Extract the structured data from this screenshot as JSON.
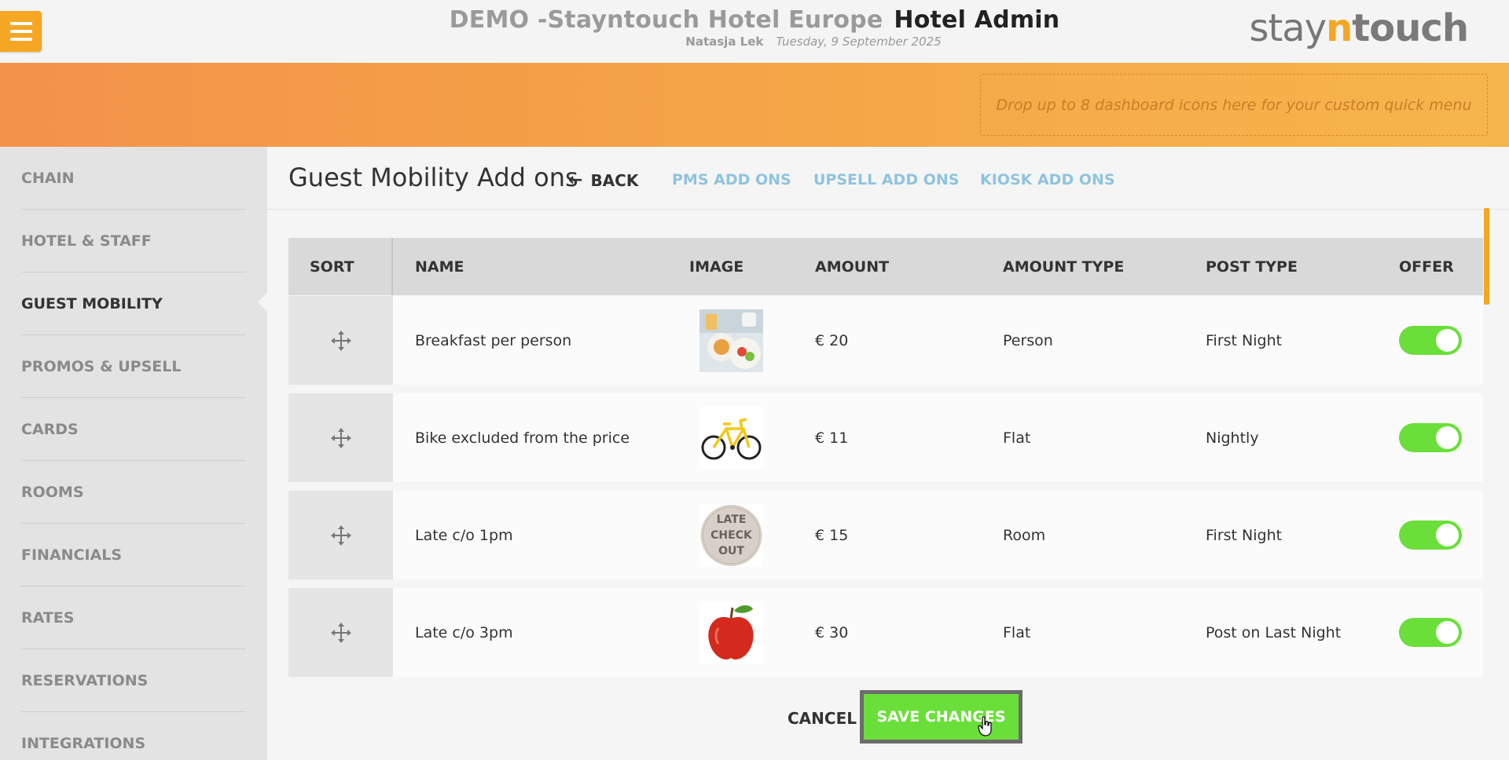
{
  "header": {
    "hotel_name": "DEMO -Stayntouch Hotel Europe",
    "app_name": "Hotel Admin",
    "user": "Natasja Lek",
    "date": "Tuesday, 9 September 2025",
    "brand_pre": "stay",
    "brand_n": "n",
    "brand_post": "touch",
    "quickmenu_placeholder": "Drop up to 8 dashboard icons here for your custom quick menu"
  },
  "sidebar": {
    "items": [
      {
        "label": "CHAIN",
        "active": false
      },
      {
        "label": "HOTEL & STAFF",
        "active": false
      },
      {
        "label": "GUEST MOBILITY",
        "active": true
      },
      {
        "label": "PROMOS & UPSELL",
        "active": false
      },
      {
        "label": "CARDS",
        "active": false
      },
      {
        "label": "ROOMS",
        "active": false
      },
      {
        "label": "FINANCIALS",
        "active": false
      },
      {
        "label": "RATES",
        "active": false
      },
      {
        "label": "RESERVATIONS",
        "active": false
      },
      {
        "label": "INTEGRATIONS",
        "active": false
      }
    ]
  },
  "page": {
    "title": "Guest Mobility Add ons",
    "back_label": "BACK",
    "tabs": [
      "PMS ADD ONS",
      "UPSELL ADD ONS",
      "KIOSK ADD ONS"
    ]
  },
  "table": {
    "columns": [
      "SORT",
      "NAME",
      "IMAGE",
      "AMOUNT",
      "AMOUNT TYPE",
      "POST TYPE",
      "OFFER"
    ],
    "rows": [
      {
        "name": "Breakfast per person",
        "image": "breakfast",
        "amount": "€ 20",
        "amount_type": "Person",
        "post_type": "First Night",
        "offer": true
      },
      {
        "name": "Bike excluded from the price",
        "image": "bike",
        "amount": "€ 11",
        "amount_type": "Flat",
        "post_type": "Nightly",
        "offer": true
      },
      {
        "name": "Late c/o 1pm",
        "image": "late-checkout",
        "amount": "€ 15",
        "amount_type": "Room",
        "post_type": "First Night",
        "offer": true
      },
      {
        "name": "Late c/o 3pm",
        "image": "apple",
        "amount": "€ 30",
        "amount_type": "Flat",
        "post_type": "Post on Last Night",
        "offer": true
      }
    ]
  },
  "late_checkout_text": [
    "LATE",
    "CHECK",
    "OUT"
  ],
  "actions": {
    "cancel_label": "CANCEL",
    "save_label": "SAVE CHANGES"
  },
  "colors": {
    "accent": "#f5a623",
    "toggle_on": "#6adf3a",
    "tab_link": "#8fc3df"
  }
}
